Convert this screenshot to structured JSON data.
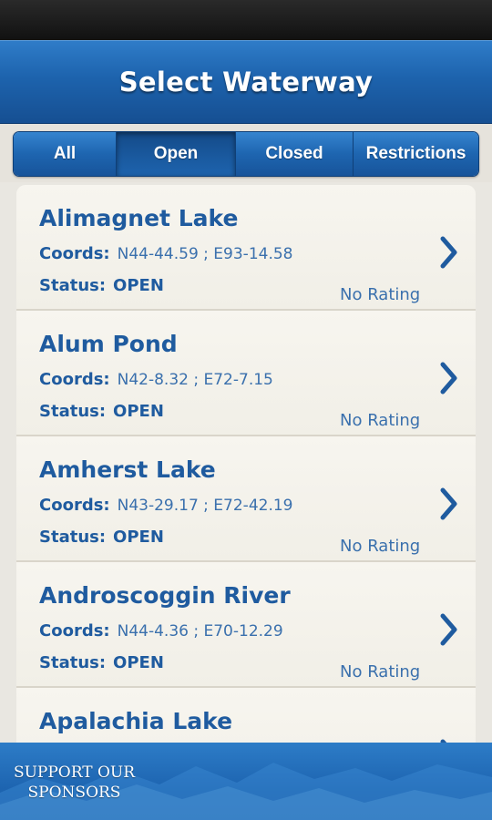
{
  "header": {
    "title": "Select Waterway"
  },
  "filters": {
    "tabs": [
      {
        "label": "All",
        "active": false
      },
      {
        "label": "Open",
        "active": true
      },
      {
        "label": "Closed",
        "active": false
      },
      {
        "label": "Restrictions",
        "active": false
      }
    ]
  },
  "labels": {
    "coords": "Coords:",
    "status": "Status:"
  },
  "waterways": [
    {
      "name": "Alimagnet Lake",
      "coords": "N44-44.59 ; E93-14.58",
      "status": "OPEN",
      "rating": "No Rating"
    },
    {
      "name": "Alum Pond",
      "coords": "N42-8.32 ; E72-7.15",
      "status": "OPEN",
      "rating": "No Rating"
    },
    {
      "name": "Amherst Lake",
      "coords": "N43-29.17 ; E72-42.19",
      "status": "OPEN",
      "rating": "No Rating"
    },
    {
      "name": "Androscoggin River",
      "coords": "N44-4.36 ; E70-12.29",
      "status": "OPEN",
      "rating": "No Rating"
    },
    {
      "name": "Apalachia Lake",
      "coords": "",
      "status": "",
      "rating": ""
    }
  ],
  "footer": {
    "sponsor_line1": "SUPPORT OUR",
    "sponsor_line2": "SPONSORS"
  },
  "colors": {
    "brand_blue": "#1d63ad",
    "text_blue": "#1f5b9f",
    "background": "#e9e7e1"
  },
  "icons": {
    "row_arrow": "chevron-right-icon"
  }
}
